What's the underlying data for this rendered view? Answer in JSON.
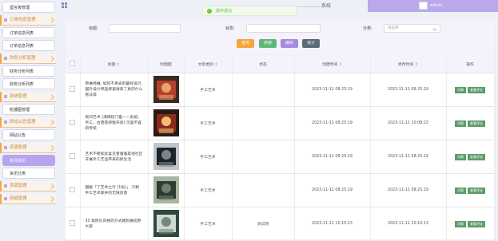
{
  "sidebar": {
    "items": [
      {
        "type": "item",
        "label": "留言板管理"
      },
      {
        "type": "section",
        "label": "订单信息管理"
      },
      {
        "type": "item",
        "label": "订单信息列表"
      },
      {
        "type": "item",
        "label": "订单信息列表"
      },
      {
        "type": "section",
        "label": "财务分析管理"
      },
      {
        "type": "item",
        "label": "财务分析列表"
      },
      {
        "type": "item",
        "label": "财务分析列表"
      },
      {
        "type": "section",
        "label": "系统管理"
      },
      {
        "type": "item",
        "label": "轮播图管理"
      },
      {
        "type": "section",
        "label": "网站公告管理"
      },
      {
        "type": "item",
        "label": "网站公告"
      },
      {
        "type": "section",
        "label": "资源管理"
      },
      {
        "type": "item",
        "label": "新闻资讯",
        "active": true
      },
      {
        "type": "item",
        "label": "资讯分类"
      },
      {
        "type": "section",
        "label": "资源管理"
      },
      {
        "type": "section",
        "label": "商城管理"
      }
    ]
  },
  "header": {
    "system_name": "…………………系统",
    "username": "admin"
  },
  "toast": {
    "icon": "check-circle-icon",
    "text": "操作成功"
  },
  "search": {
    "title_label": "标题:",
    "status_label": "状态:",
    "category_label": "分类:",
    "category_placeholder": "请选择"
  },
  "buttons": {
    "query": "查询",
    "add": "新增",
    "delete": "删除",
    "statistics": "统计"
  },
  "colors": {
    "accent": "#b9a8ea",
    "query_btn": "#f4a63c",
    "add_btn": "#5fb878",
    "delete_btn": "#a58bdc",
    "stat_btn": "#5a6a7a",
    "action_btn": "#5d9b6a"
  },
  "table": {
    "columns": [
      "",
      "标题",
      "封面图",
      "文章类别",
      "状态",
      "创建时间",
      "修改时间",
      "操作"
    ],
    "rows": [
      {
        "title": "参展特展, 如何不离省的最好设计, 国外设计师选择邀请来了真的什么看法等",
        "category": "手工艺术",
        "status": "",
        "created": "2023-11-11 08:25:19",
        "updated": "2023-11-11 08:25:19",
        "actions": [
          "详情",
          "查看评论"
        ]
      },
      {
        "title": "民间艺术 (演绎技门槛——剪纸、手工、古建等感慨开发) 可喜不喜的传统",
        "category": "手工艺术",
        "status": "",
        "created": "2023-11-11 08:25:19",
        "updated": "2023-11-11 10:08:23",
        "actions": [
          "详情",
          "查看评论"
        ]
      },
      {
        "title": "艺术不要如此喜见者遵循其他社区开展手工艺品带来的新生活",
        "category": "手工艺术",
        "status": "",
        "created": "2023-11-11 08:25:19",
        "updated": "2023-11-11 08:25:19",
        "actions": [
          "详情",
          "查看评论"
        ]
      },
      {
        "title": "图解「了艺术之行 (1张)」 只剩手工艺术家并的无限创意",
        "category": "手工艺术",
        "status": "",
        "created": "2023-11-11 08:25:19",
        "updated": "2023-11-11 08:25:19",
        "actions": [
          "详情",
          "查看评论"
        ]
      },
      {
        "title": "33 家民队风格的方式路则展成熟大家",
        "category": "手工艺术",
        "status": "测试项",
        "created": "2023-11-11 10:10:13",
        "updated": "2023-11-11 10:10:13",
        "actions": [
          "详情",
          "查看评论"
        ]
      }
    ]
  }
}
